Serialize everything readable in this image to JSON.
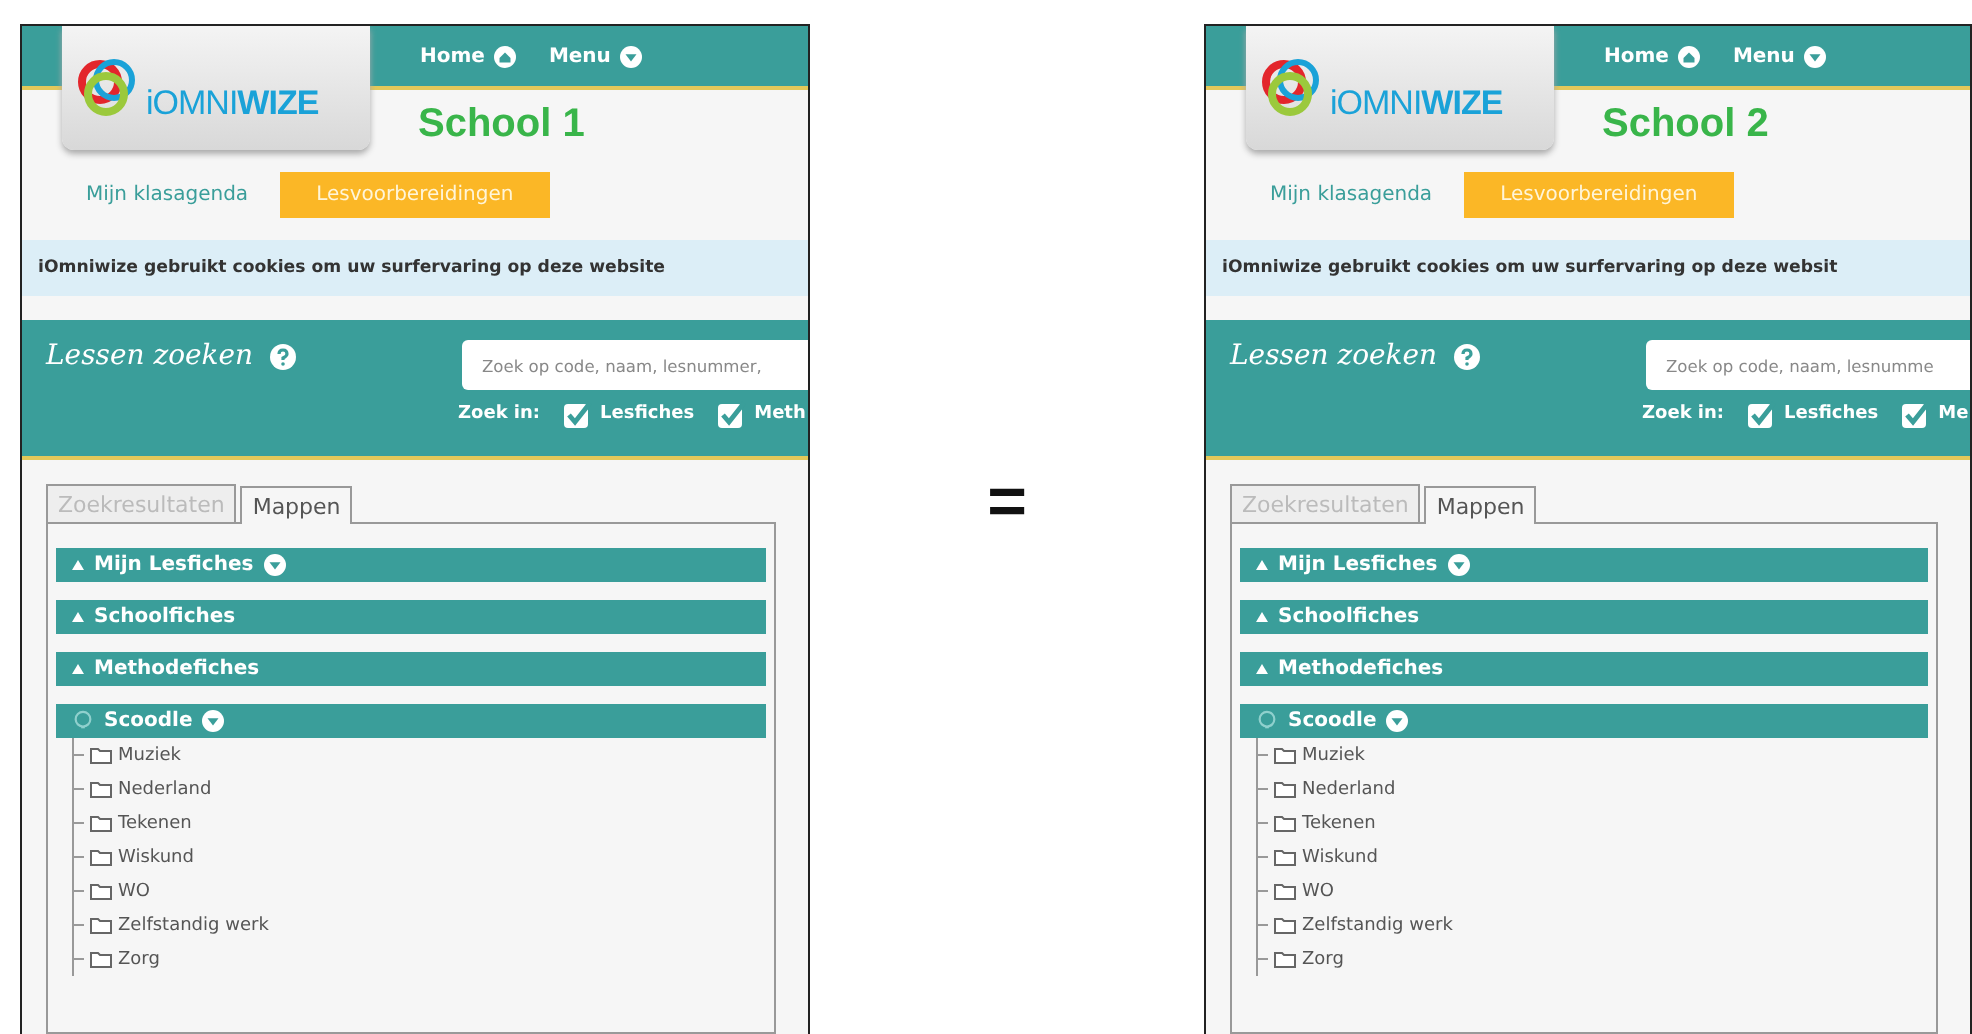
{
  "panels": [
    {
      "nav": [
        {
          "label": "Home"
        },
        {
          "label": "Menu"
        }
      ],
      "logo": "iOMNI**WIZE**",
      "school": "School 1",
      "tabs": [
        {
          "label": "Mijn klasagenda",
          "selected": false
        },
        {
          "label": "Lesvoorbereidingen",
          "selected": true
        }
      ],
      "cookie_notice": "iOmniwize gebruikt cookies om uw surfervaring op deze website",
      "search": {
        "title": "Lessen zoeken",
        "placeholder": "Zoek op code, naam, lesnummer,",
        "filter_label": "Zoek in:",
        "filters": [
          {
            "label": "Lesfiches",
            "checked": true
          },
          {
            "label": "Meth",
            "checked": true
          }
        ]
      },
      "result_tabs": [
        {
          "label": "Zoekresultaten",
          "selected": false
        },
        {
          "label": "Mappen",
          "selected": true
        }
      ],
      "sections": [
        {
          "label": "Mijn Lesfiches",
          "expanded": false,
          "has_menu": true
        },
        {
          "label": "Schoolfiches",
          "expanded": false,
          "has_menu": false
        },
        {
          "label": "Methodefiches",
          "expanded": false,
          "has_menu": false
        },
        {
          "label": "Scoodle",
          "expanded": true,
          "has_menu": true,
          "children": [
            "Muziek",
            "Nederland",
            "Tekenen",
            "Wiskund",
            "WO",
            "Zelfstandig werk",
            "Zorg"
          ]
        }
      ]
    },
    {
      "nav": [
        {
          "label": "Home"
        },
        {
          "label": "Menu"
        }
      ],
      "logo": "iOMNI**WIZE**",
      "school": "School 2",
      "tabs": [
        {
          "label": "Mijn klasagenda",
          "selected": false
        },
        {
          "label": "Lesvoorbereidingen",
          "selected": true
        }
      ],
      "cookie_notice": "iOmniwize gebruikt cookies om uw surfervaring op deze websit",
      "search": {
        "title": "Lessen zoeken",
        "placeholder": "Zoek op code, naam, lesnumme",
        "filter_label": "Zoek in:",
        "filters": [
          {
            "label": "Lesfiches",
            "checked": true
          },
          {
            "label": "Me",
            "checked": true
          }
        ]
      },
      "result_tabs": [
        {
          "label": "Zoekresultaten",
          "selected": false
        },
        {
          "label": "Mappen",
          "selected": true
        }
      ],
      "sections": [
        {
          "label": "Mijn Lesfiches",
          "expanded": false,
          "has_menu": true
        },
        {
          "label": "Schoolfiches",
          "expanded": false,
          "has_menu": false
        },
        {
          "label": "Methodefiches",
          "expanded": false,
          "has_menu": false
        },
        {
          "label": "Scoodle",
          "expanded": true,
          "has_menu": true,
          "children": [
            "Muziek",
            "Nederland",
            "Tekenen",
            "Wiskund",
            "WO",
            "Zelfstandig werk",
            "Zorg"
          ]
        }
      ]
    }
  ],
  "equals_sign": "="
}
